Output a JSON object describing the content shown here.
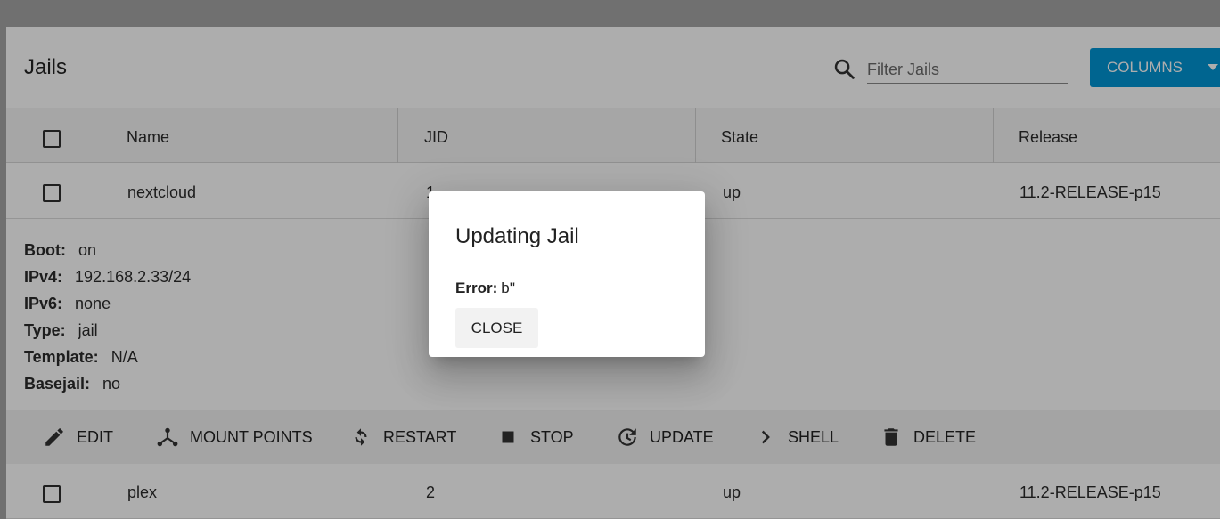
{
  "header": {
    "title": "Jails",
    "search_placeholder": "Filter Jails",
    "columns_label": "COLUMNS"
  },
  "table": {
    "columns": [
      "Name",
      "JID",
      "State",
      "Release"
    ],
    "rows": [
      {
        "name": "nextcloud",
        "jid": "1",
        "state": "up",
        "release": "11.2-RELEASE-p15"
      },
      {
        "name": "plex",
        "jid": "2",
        "state": "up",
        "release": "11.2-RELEASE-p15"
      }
    ]
  },
  "details": {
    "boot_label": "Boot:",
    "boot": "on",
    "ipv4_label": "IPv4:",
    "ipv4": "192.168.2.33/24",
    "ipv6_label": "IPv6:",
    "ipv6": "none",
    "type_label": "Type:",
    "type": "jail",
    "template_label": "Template:",
    "template": "N/A",
    "basejail_label": "Basejail:",
    "basejail": "no"
  },
  "actions": {
    "edit": "EDIT",
    "mount_points": "MOUNT POINTS",
    "restart": "RESTART",
    "stop": "STOP",
    "update": "UPDATE",
    "shell": "SHELL",
    "delete": "DELETE"
  },
  "dialog": {
    "title": "Updating Jail",
    "error_label": "Error:",
    "error_value": "b''",
    "close_label": "CLOSE"
  },
  "colors": {
    "accent": "#0095d5",
    "overlay": "#000000"
  }
}
